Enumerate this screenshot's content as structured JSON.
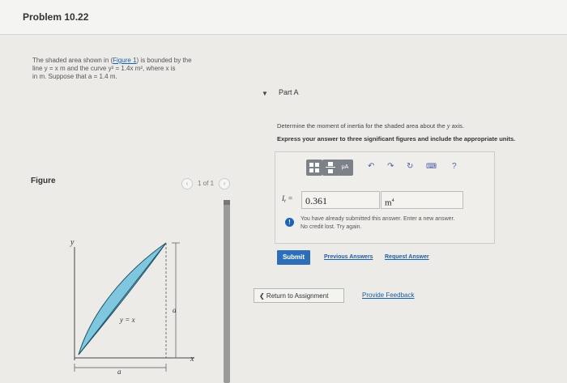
{
  "header": {
    "title": "Problem 10.22"
  },
  "problem": {
    "line1_pre": "The shaded area shown in (",
    "figure_link": "Figure 1",
    "line1_post": ") is bounded by the",
    "line2": "line y = x m and the curve y² = 1.4x m², where x is",
    "line3": "in m. Suppose that a = 1.4 m."
  },
  "figure": {
    "label": "Figure",
    "pager_text": "1 of 1",
    "prev_icon": "chevron-left-icon",
    "next_icon": "chevron-right-icon",
    "axis_y": "y",
    "axis_x": "x",
    "curve_label": "y = x",
    "dim_a_vertical": "a",
    "dim_a_horizontal": "a",
    "fill_color": "#7fc6df"
  },
  "part": {
    "collapse_icon": "triangle-down-icon",
    "title": "Part A",
    "instruction_pre": "Determine the moment of inertia for the shaded area about the ",
    "instruction_var": "y",
    "instruction_post": " axis.",
    "express": "Express your answer to three significant figures and include the appropriate units."
  },
  "toolbar": {
    "templates_icon": "templates-icon",
    "units_label": "μA",
    "undo_icon": "undo-icon",
    "redo_icon": "redo-icon",
    "reset_icon": "reset-icon",
    "keyboard_icon": "keyboard-icon",
    "help_label": "?"
  },
  "answer": {
    "var_label": "Iᵧ =",
    "value": "0.361",
    "unit_base": "m",
    "unit_exp": "4"
  },
  "feedback": {
    "icon": "info-icon",
    "line1": "You have already submitted this answer. Enter a new answer.",
    "line2": "No credit lost. Try again."
  },
  "actions": {
    "submit": "Submit",
    "previous_answers": "Previous Answers",
    "request_answer": "Request Answer",
    "return": "❮ Return to Assignment",
    "provide_feedback": "Provide Feedback"
  },
  "colors": {
    "accent": "#2e6eb9",
    "link": "#1a5ea8",
    "info": "#1d63b8"
  }
}
